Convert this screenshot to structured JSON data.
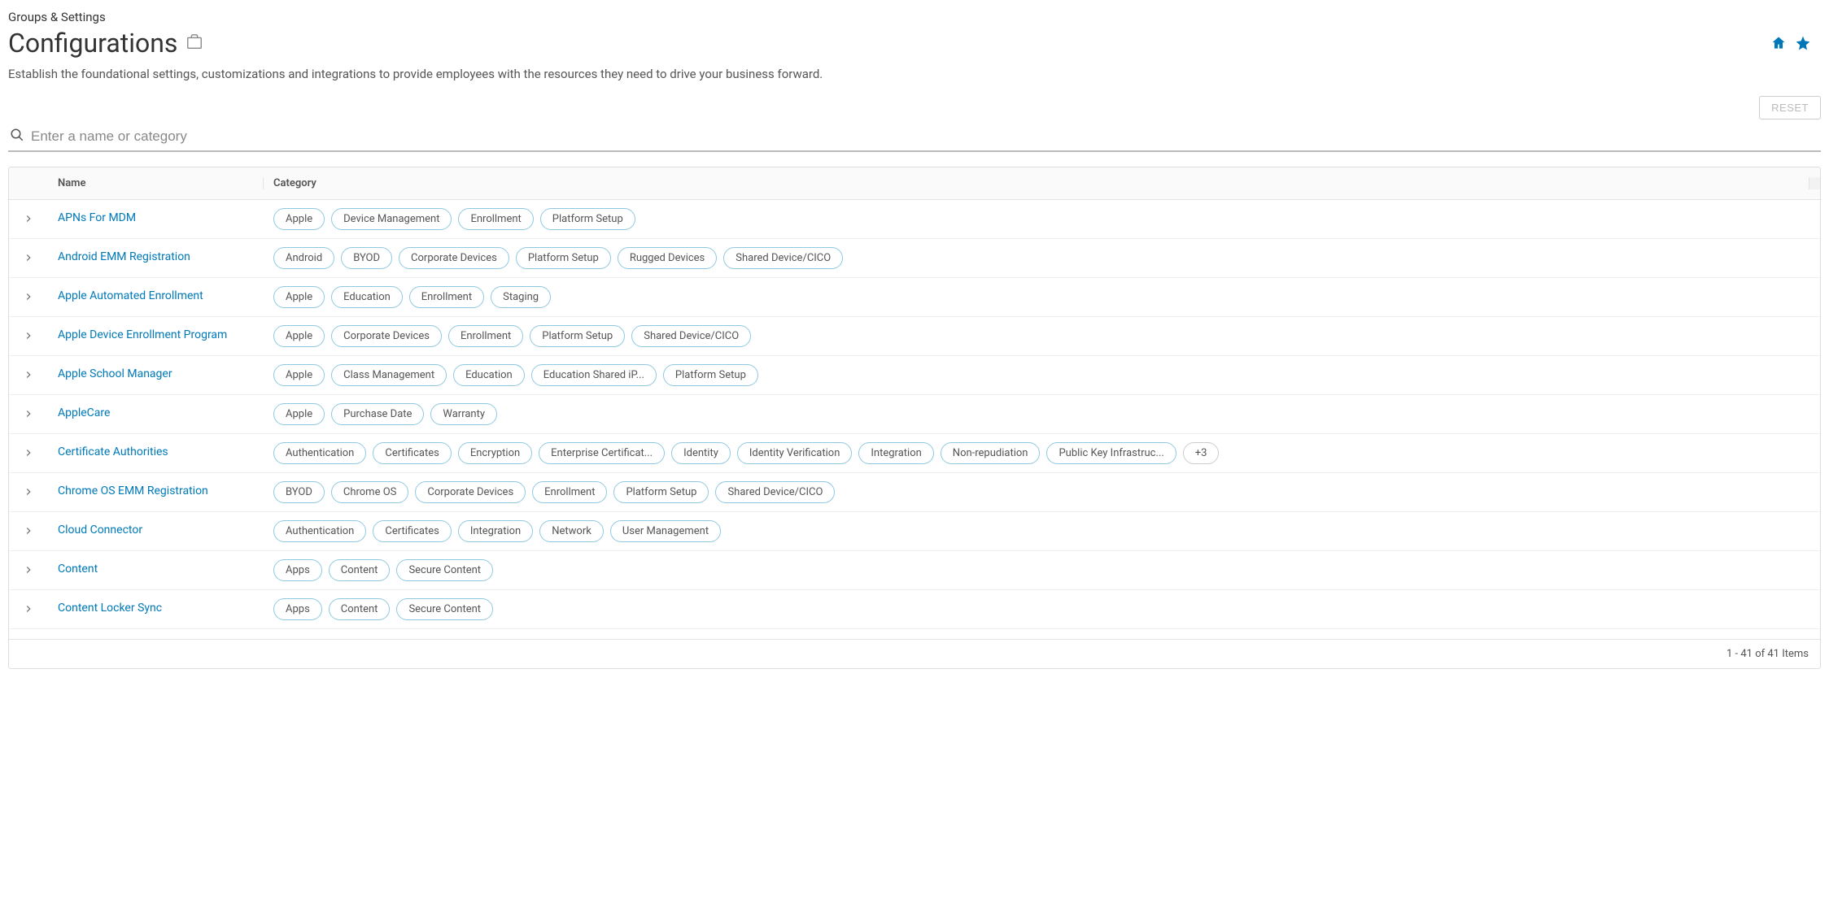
{
  "breadcrumb": "Groups & Settings",
  "page_title": "Configurations",
  "description": "Establish the foundational settings, customizations and integrations to provide employees with the resources they need to drive your business forward.",
  "reset_label": "RESET",
  "search_placeholder": "Enter a name or category",
  "columns": {
    "name": "Name",
    "category": "Category"
  },
  "footer": "1 - 41 of 41 Items",
  "rows": [
    {
      "name": "APNs For MDM",
      "tags": [
        "Apple",
        "Device Management",
        "Enrollment",
        "Platform Setup"
      ]
    },
    {
      "name": "Android EMM Registration",
      "tags": [
        "Android",
        "BYOD",
        "Corporate Devices",
        "Platform Setup",
        "Rugged Devices",
        "Shared Device/CICO"
      ]
    },
    {
      "name": "Apple Automated Enrollment",
      "tags": [
        "Apple",
        "Education",
        "Enrollment",
        "Staging"
      ]
    },
    {
      "name": "Apple Device Enrollment Program",
      "tags": [
        "Apple",
        "Corporate Devices",
        "Enrollment",
        "Platform Setup",
        "Shared Device/CICO"
      ]
    },
    {
      "name": "Apple School Manager",
      "tags": [
        "Apple",
        "Class Management",
        "Education",
        "Education Shared iP...",
        "Platform Setup"
      ]
    },
    {
      "name": "AppleCare",
      "tags": [
        "Apple",
        "Purchase Date",
        "Warranty"
      ]
    },
    {
      "name": "Certificate Authorities",
      "tags": [
        "Authentication",
        "Certificates",
        "Encryption",
        "Enterprise Certificat...",
        "Identity",
        "Identity Verification",
        "Integration",
        "Non-repudiation",
        "Public Key Infrastruc..."
      ],
      "more": "+3"
    },
    {
      "name": "Chrome OS EMM Registration",
      "tags": [
        "BYOD",
        "Chrome OS",
        "Corporate Devices",
        "Enrollment",
        "Platform Setup",
        "Shared Device/CICO"
      ]
    },
    {
      "name": "Cloud Connector",
      "tags": [
        "Authentication",
        "Certificates",
        "Integration",
        "Network",
        "User Management"
      ]
    },
    {
      "name": "Content",
      "tags": [
        "Apps",
        "Content",
        "Secure Content"
      ]
    },
    {
      "name": "Content Locker Sync",
      "tags": [
        "Apps",
        "Content",
        "Secure Content"
      ]
    }
  ]
}
